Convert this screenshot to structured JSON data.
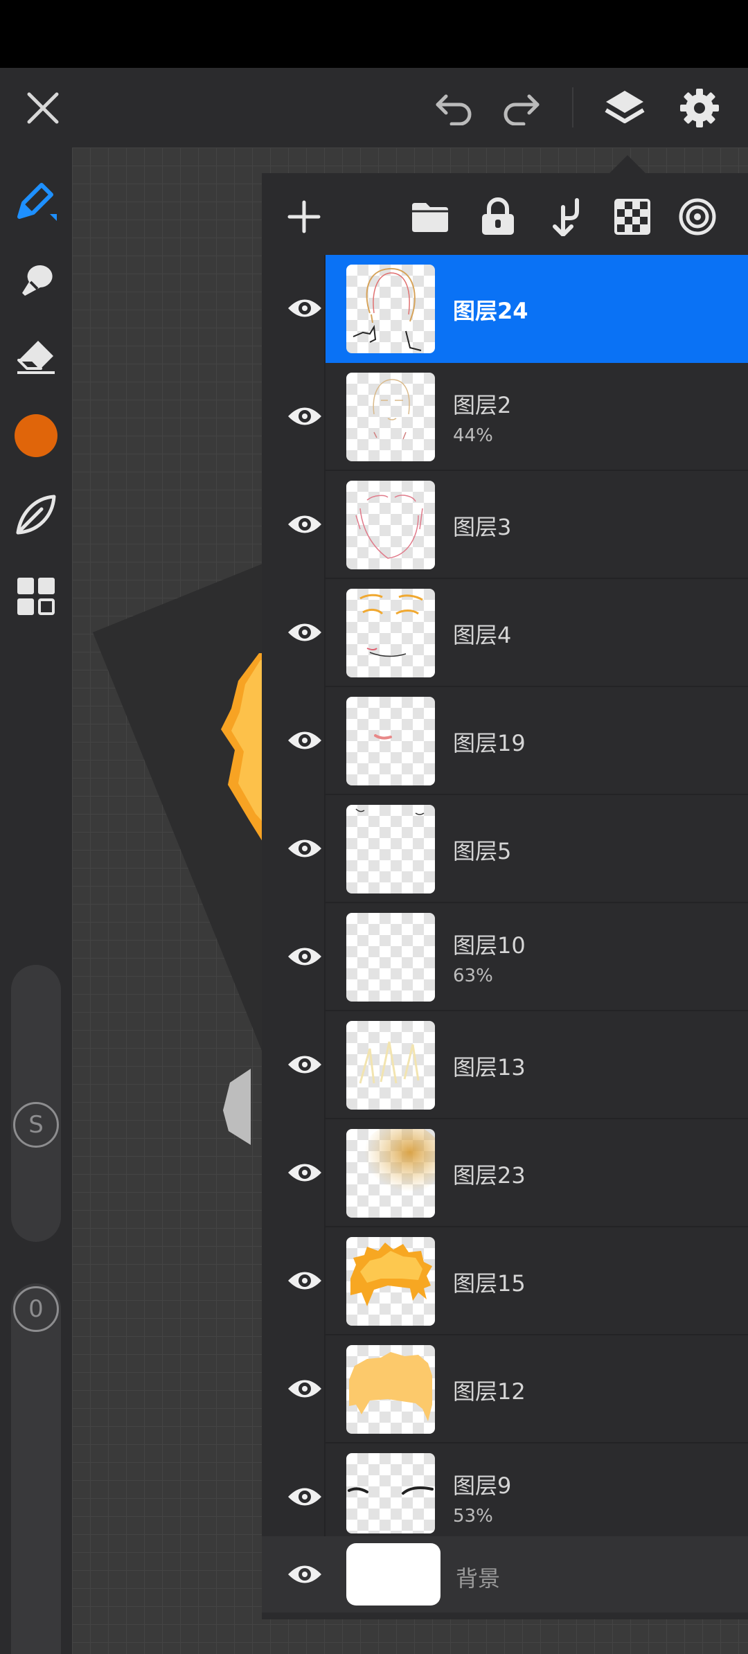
{
  "topbar": {
    "close_icon": "close-icon",
    "undo_icon": "undo-icon",
    "redo_icon": "redo-icon",
    "layers_icon": "layers-icon",
    "settings_icon": "gear-icon"
  },
  "sidebar": {
    "tools": [
      "pen-icon",
      "smudge-icon",
      "eraser-icon",
      "color-swatch",
      "leaf-icon",
      "grid-icon"
    ],
    "color": "#e0650a",
    "size_label": "S",
    "opacity_label": "0"
  },
  "layers_panel": {
    "toolbar": [
      "add-icon",
      "folder-icon",
      "lock-icon",
      "merge-down-icon",
      "checker-icon",
      "target-icon"
    ],
    "layers": [
      {
        "name": "图层24",
        "opacity": "",
        "selected": true
      },
      {
        "name": "图层2",
        "opacity": "44%"
      },
      {
        "name": "图层3",
        "opacity": ""
      },
      {
        "name": "图层4",
        "opacity": ""
      },
      {
        "name": "图层19",
        "opacity": ""
      },
      {
        "name": "图层5",
        "opacity": ""
      },
      {
        "name": "图层10",
        "opacity": "63%"
      },
      {
        "name": "图层13",
        "opacity": ""
      },
      {
        "name": "图层23",
        "opacity": ""
      },
      {
        "name": "图层15",
        "opacity": ""
      },
      {
        "name": "图层12",
        "opacity": ""
      },
      {
        "name": "图层9",
        "opacity": "53%"
      }
    ],
    "background_layer": {
      "name": "背景"
    }
  }
}
